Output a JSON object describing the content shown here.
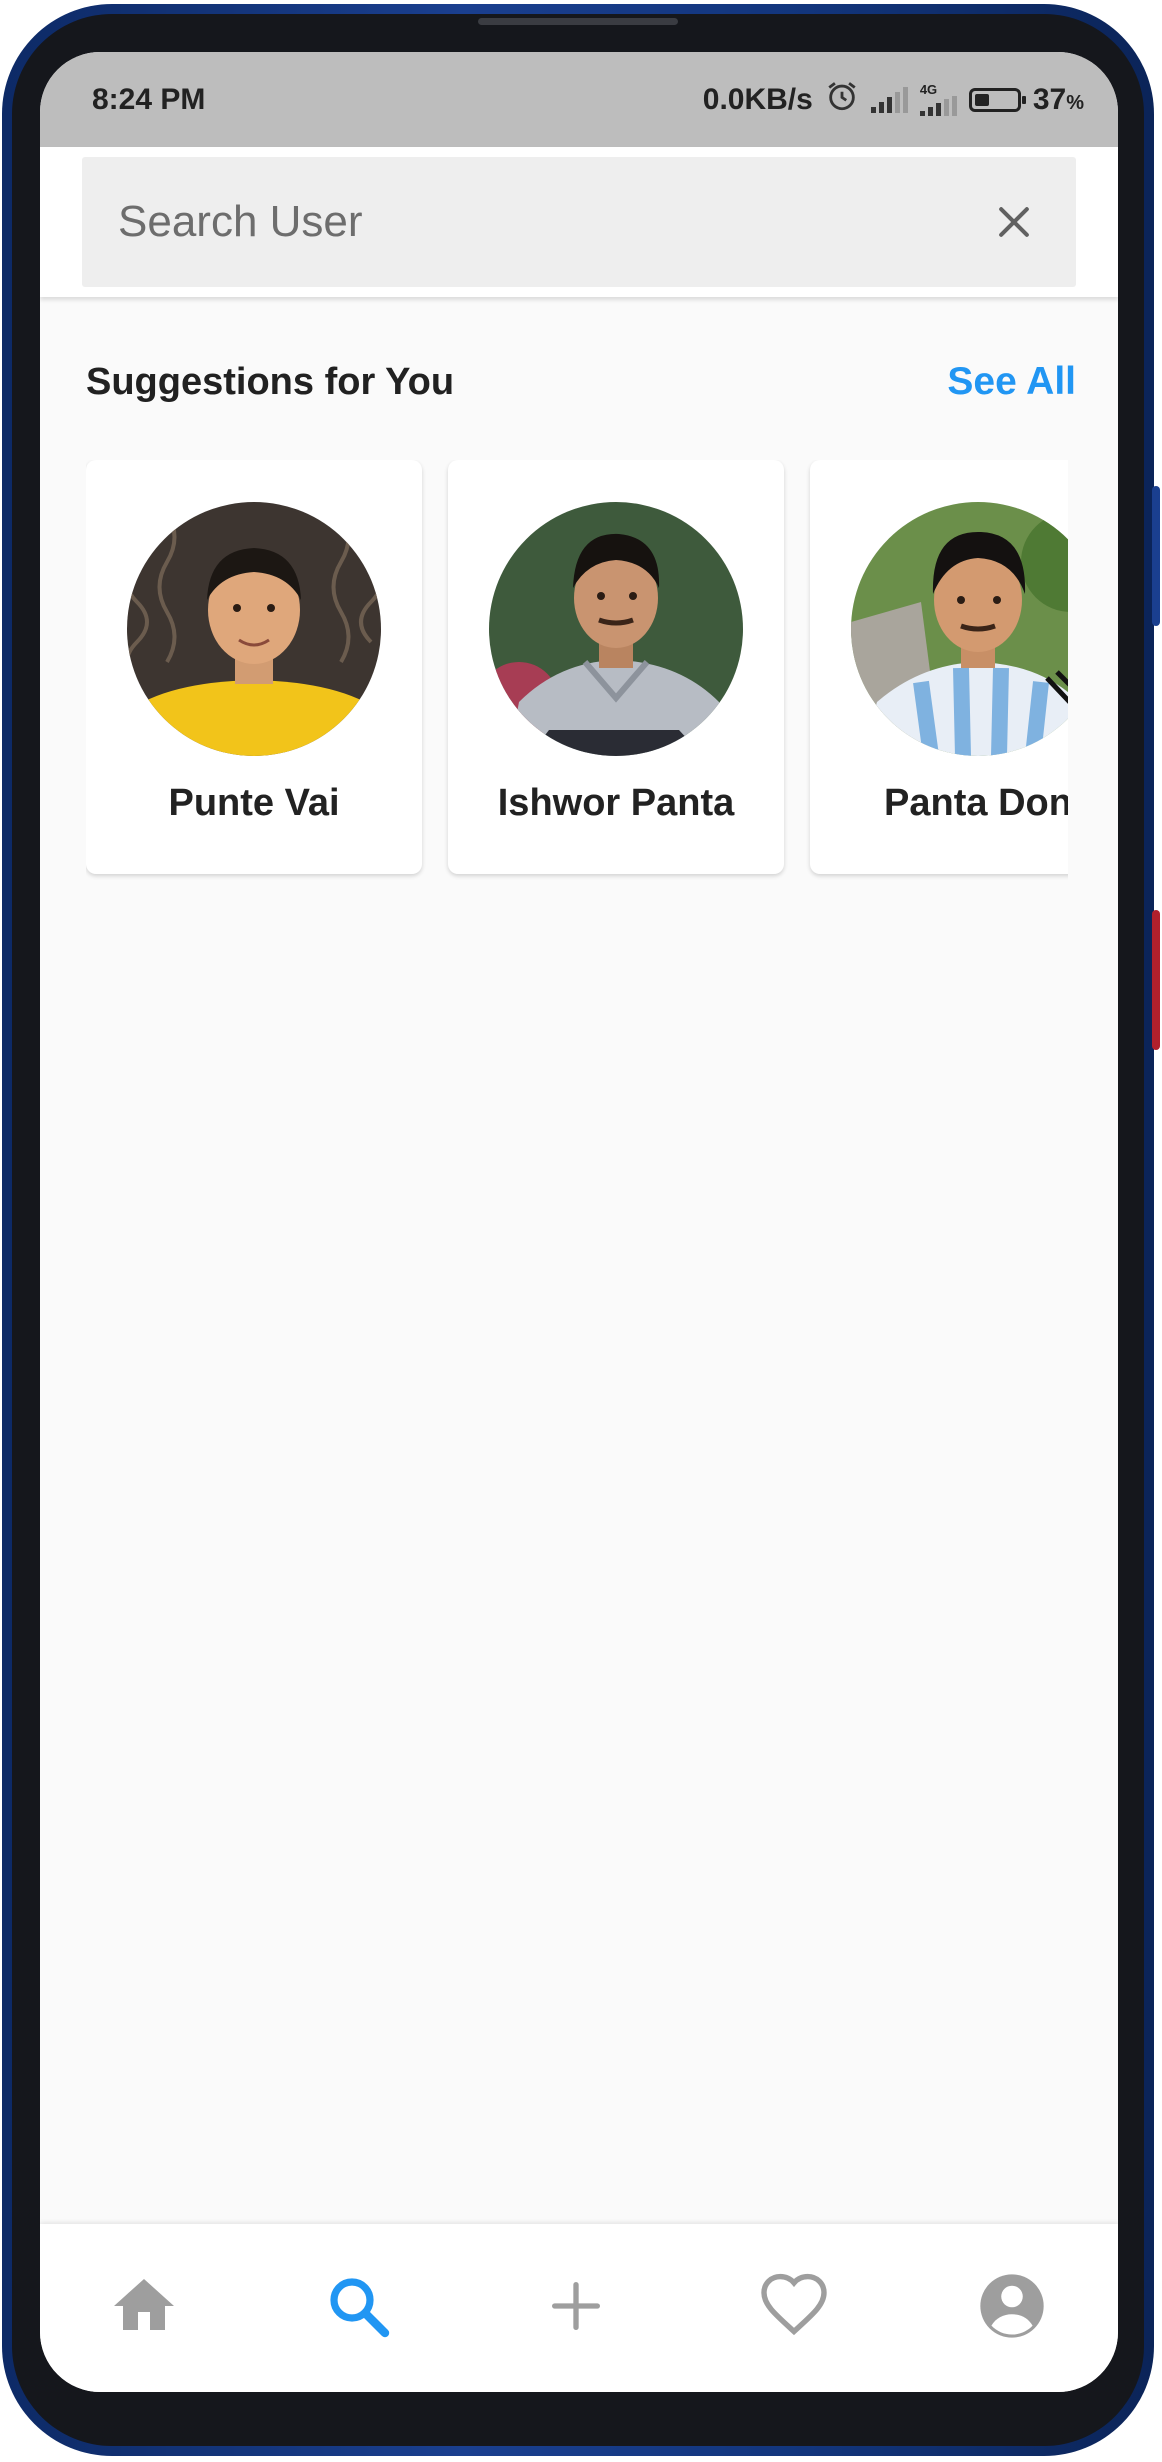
{
  "status_bar": {
    "time": "8:24 PM",
    "network_speed": "0.0KB/s",
    "network_type": "4G",
    "battery_percent": "37",
    "battery_unit": "%"
  },
  "search": {
    "placeholder": "Search User",
    "value": "",
    "clear_icon": "close-icon"
  },
  "suggestions": {
    "title": "Suggestions for You",
    "see_all_label": "See All",
    "see_all_color": "#2196f3",
    "users": [
      {
        "name": "Punte Vai",
        "avatar": "avatar-photo"
      },
      {
        "name": "Ishwor Panta",
        "avatar": "avatar-photo"
      },
      {
        "name": "Panta Don",
        "avatar": "avatar-photo"
      }
    ]
  },
  "bottom_nav": {
    "active_color": "#2196f3",
    "inactive_color": "#9e9e9e",
    "items": [
      {
        "icon": "home-icon",
        "active": false
      },
      {
        "icon": "search-icon",
        "active": true
      },
      {
        "icon": "add-icon",
        "active": false
      },
      {
        "icon": "heart-icon",
        "active": false
      },
      {
        "icon": "account-icon",
        "active": false
      }
    ]
  }
}
